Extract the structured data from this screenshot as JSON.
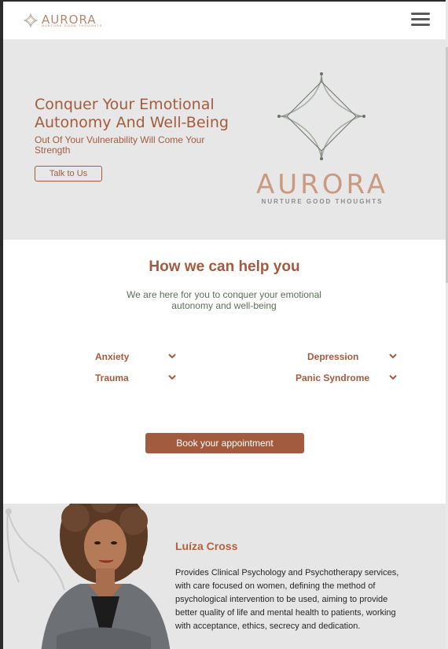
{
  "header": {
    "logo_word": "AURORA",
    "logo_tagline": "NURTURE GOOD THOUGHTS",
    "menu_icon": "hamburger-menu-icon"
  },
  "hero": {
    "title": "Conquer Your Emotional Autonomy And Well-Being",
    "subtitle": "Out Of Your Vulnerability Will Come Your Strength",
    "cta_label": "Talk to Us",
    "logo_word": "AURORA",
    "logo_tagline": "NURTURE GOOD THOUGHTS"
  },
  "help": {
    "title": "How we can help you",
    "subtitle": "We are here for you to conquer your emotional autonomy and well-being",
    "topics": [
      {
        "label": "Anxiety"
      },
      {
        "label": "Depression"
      },
      {
        "label": "Trauma"
      },
      {
        "label": "Panic Syndrome"
      }
    ],
    "book_label": "Book your appointment"
  },
  "therapist": {
    "name": "Luíza Cross",
    "bio": "Provides Clinical Psychology and Psychotherapy services, with care focused on women, defining the method of psychological intervention to be used, aiming to provide better quality of life and mental health to patients, working with acceptance, ethics, secrecy and dedication."
  },
  "colors": {
    "brand": "#a35b3f",
    "logo_peach": "#c99a80",
    "hero_bg": "#e7e7e7",
    "subtitle_green": "#5c7059"
  }
}
